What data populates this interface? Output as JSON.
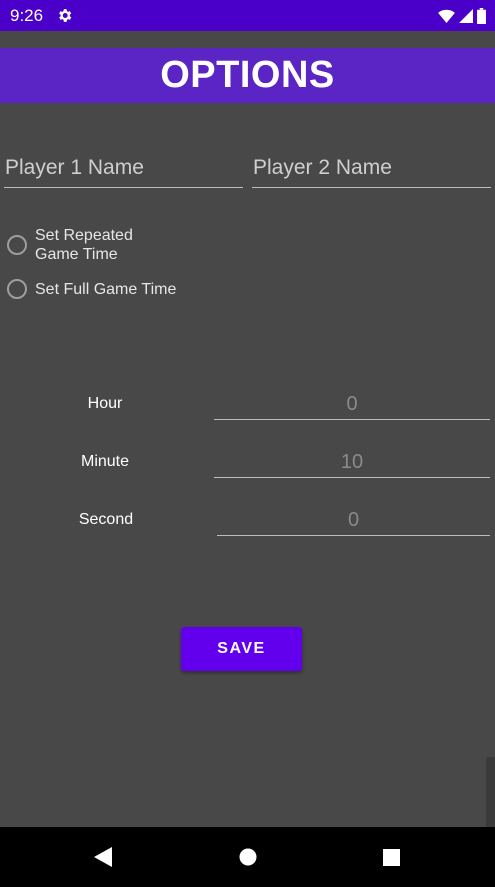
{
  "status_bar": {
    "time": "9:26",
    "icons": [
      "gear-icon",
      "wifi-icon",
      "cell-signal-icon",
      "battery-icon"
    ]
  },
  "header": {
    "title": "OPTIONS"
  },
  "players": {
    "player1_placeholder": "Player 1 Name",
    "player2_placeholder": "Player 2 Name"
  },
  "mode_options": [
    {
      "label": "Set Repeated Game Time",
      "selected": false
    },
    {
      "label": "Set Full Game Time",
      "selected": false
    }
  ],
  "time_settings": {
    "hour_label": "Hour",
    "hour_value": "0",
    "minute_label": "Minute",
    "minute_value": "10",
    "second_label": "Second",
    "second_value": "0"
  },
  "save_button": {
    "label": "SAVE"
  },
  "nav_bar": {
    "buttons": [
      "back-icon",
      "home-icon",
      "recents-icon"
    ]
  },
  "colors": {
    "status_bar": "#4a00c8",
    "title_bar": "#5b24c4",
    "background": "#484848",
    "accent": "#6200ee"
  }
}
